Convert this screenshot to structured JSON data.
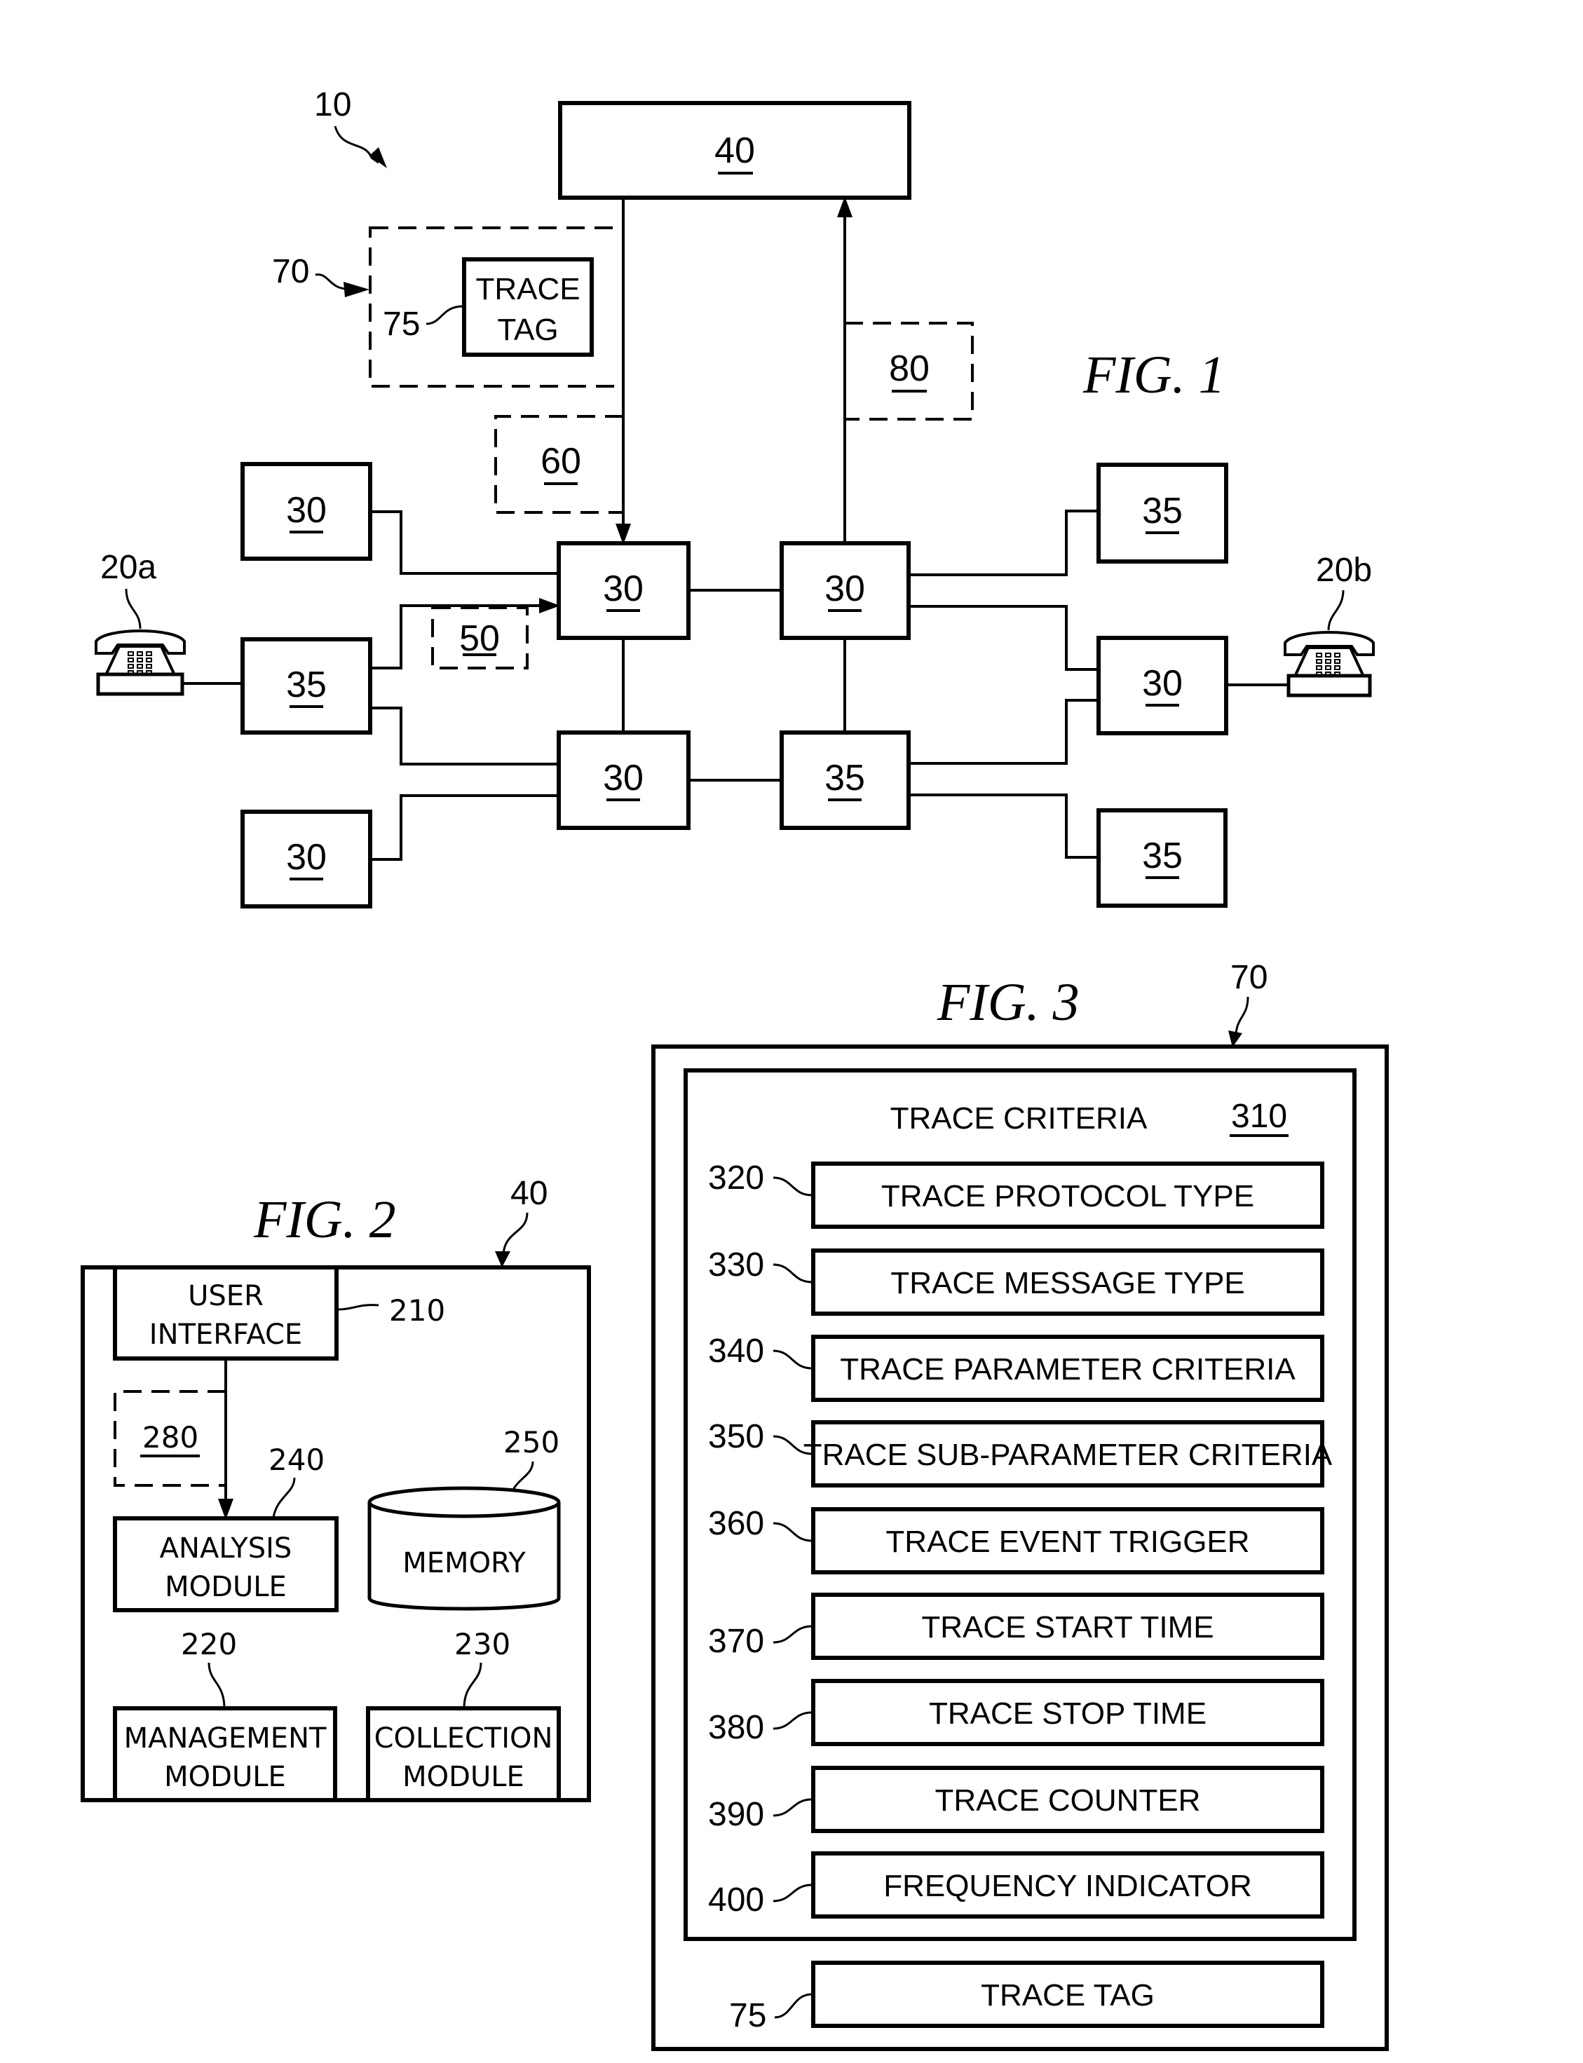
{
  "fig1": {
    "title": "FIG. 1",
    "system_ref": "10",
    "box40": "40",
    "trace_group_ref": "70",
    "trace_tag_ref": "75",
    "trace_tag_line1": "TRACE",
    "trace_tag_line2": "TAG",
    "box60": "60",
    "box80": "80",
    "box50": "50",
    "phone_a_ref": "20a",
    "phone_b_ref": "20b",
    "nodes": {
      "left_top": "30",
      "left_mid": "35",
      "left_bottom": "30",
      "center_top": "30",
      "center_bottom": "30",
      "right_top": "30",
      "right_bottom": "35",
      "far_right_top": "35",
      "far_right_mid": "30",
      "far_right_bottom": "35"
    }
  },
  "fig2": {
    "title": "FIG. 2",
    "ref": "40",
    "user_interface": {
      "ref": "210",
      "line1": "USER",
      "line2": "INTERFACE"
    },
    "box280": "280",
    "analysis": {
      "ref": "240",
      "line1": "ANALYSIS",
      "line2": "MODULE"
    },
    "memory": {
      "ref": "250",
      "label": "MEMORY"
    },
    "management": {
      "ref": "220",
      "line1": "MANAGEMENT",
      "line2": "MODULE"
    },
    "collection": {
      "ref": "230",
      "line1": "COLLECTION",
      "line2": "MODULE"
    }
  },
  "fig3": {
    "title": "FIG. 3",
    "ref": "70",
    "criteria_title": "TRACE CRITERIA",
    "criteria_ref": "310",
    "rows": [
      {
        "ref": "320",
        "label": "TRACE PROTOCOL TYPE"
      },
      {
        "ref": "330",
        "label": "TRACE MESSAGE TYPE"
      },
      {
        "ref": "340",
        "label": "TRACE PARAMETER CRITERIA"
      },
      {
        "ref": "350",
        "label": "TRACE SUB-PARAMETER CRITERIA"
      },
      {
        "ref": "360",
        "label": "TRACE EVENT TRIGGER"
      },
      {
        "ref": "370",
        "label": "TRACE START TIME"
      },
      {
        "ref": "380",
        "label": "TRACE STOP TIME"
      },
      {
        "ref": "390",
        "label": "TRACE COUNTER"
      },
      {
        "ref": "400",
        "label": "FREQUENCY INDICATOR"
      }
    ],
    "tag": {
      "ref": "75",
      "label": "TRACE TAG"
    }
  }
}
